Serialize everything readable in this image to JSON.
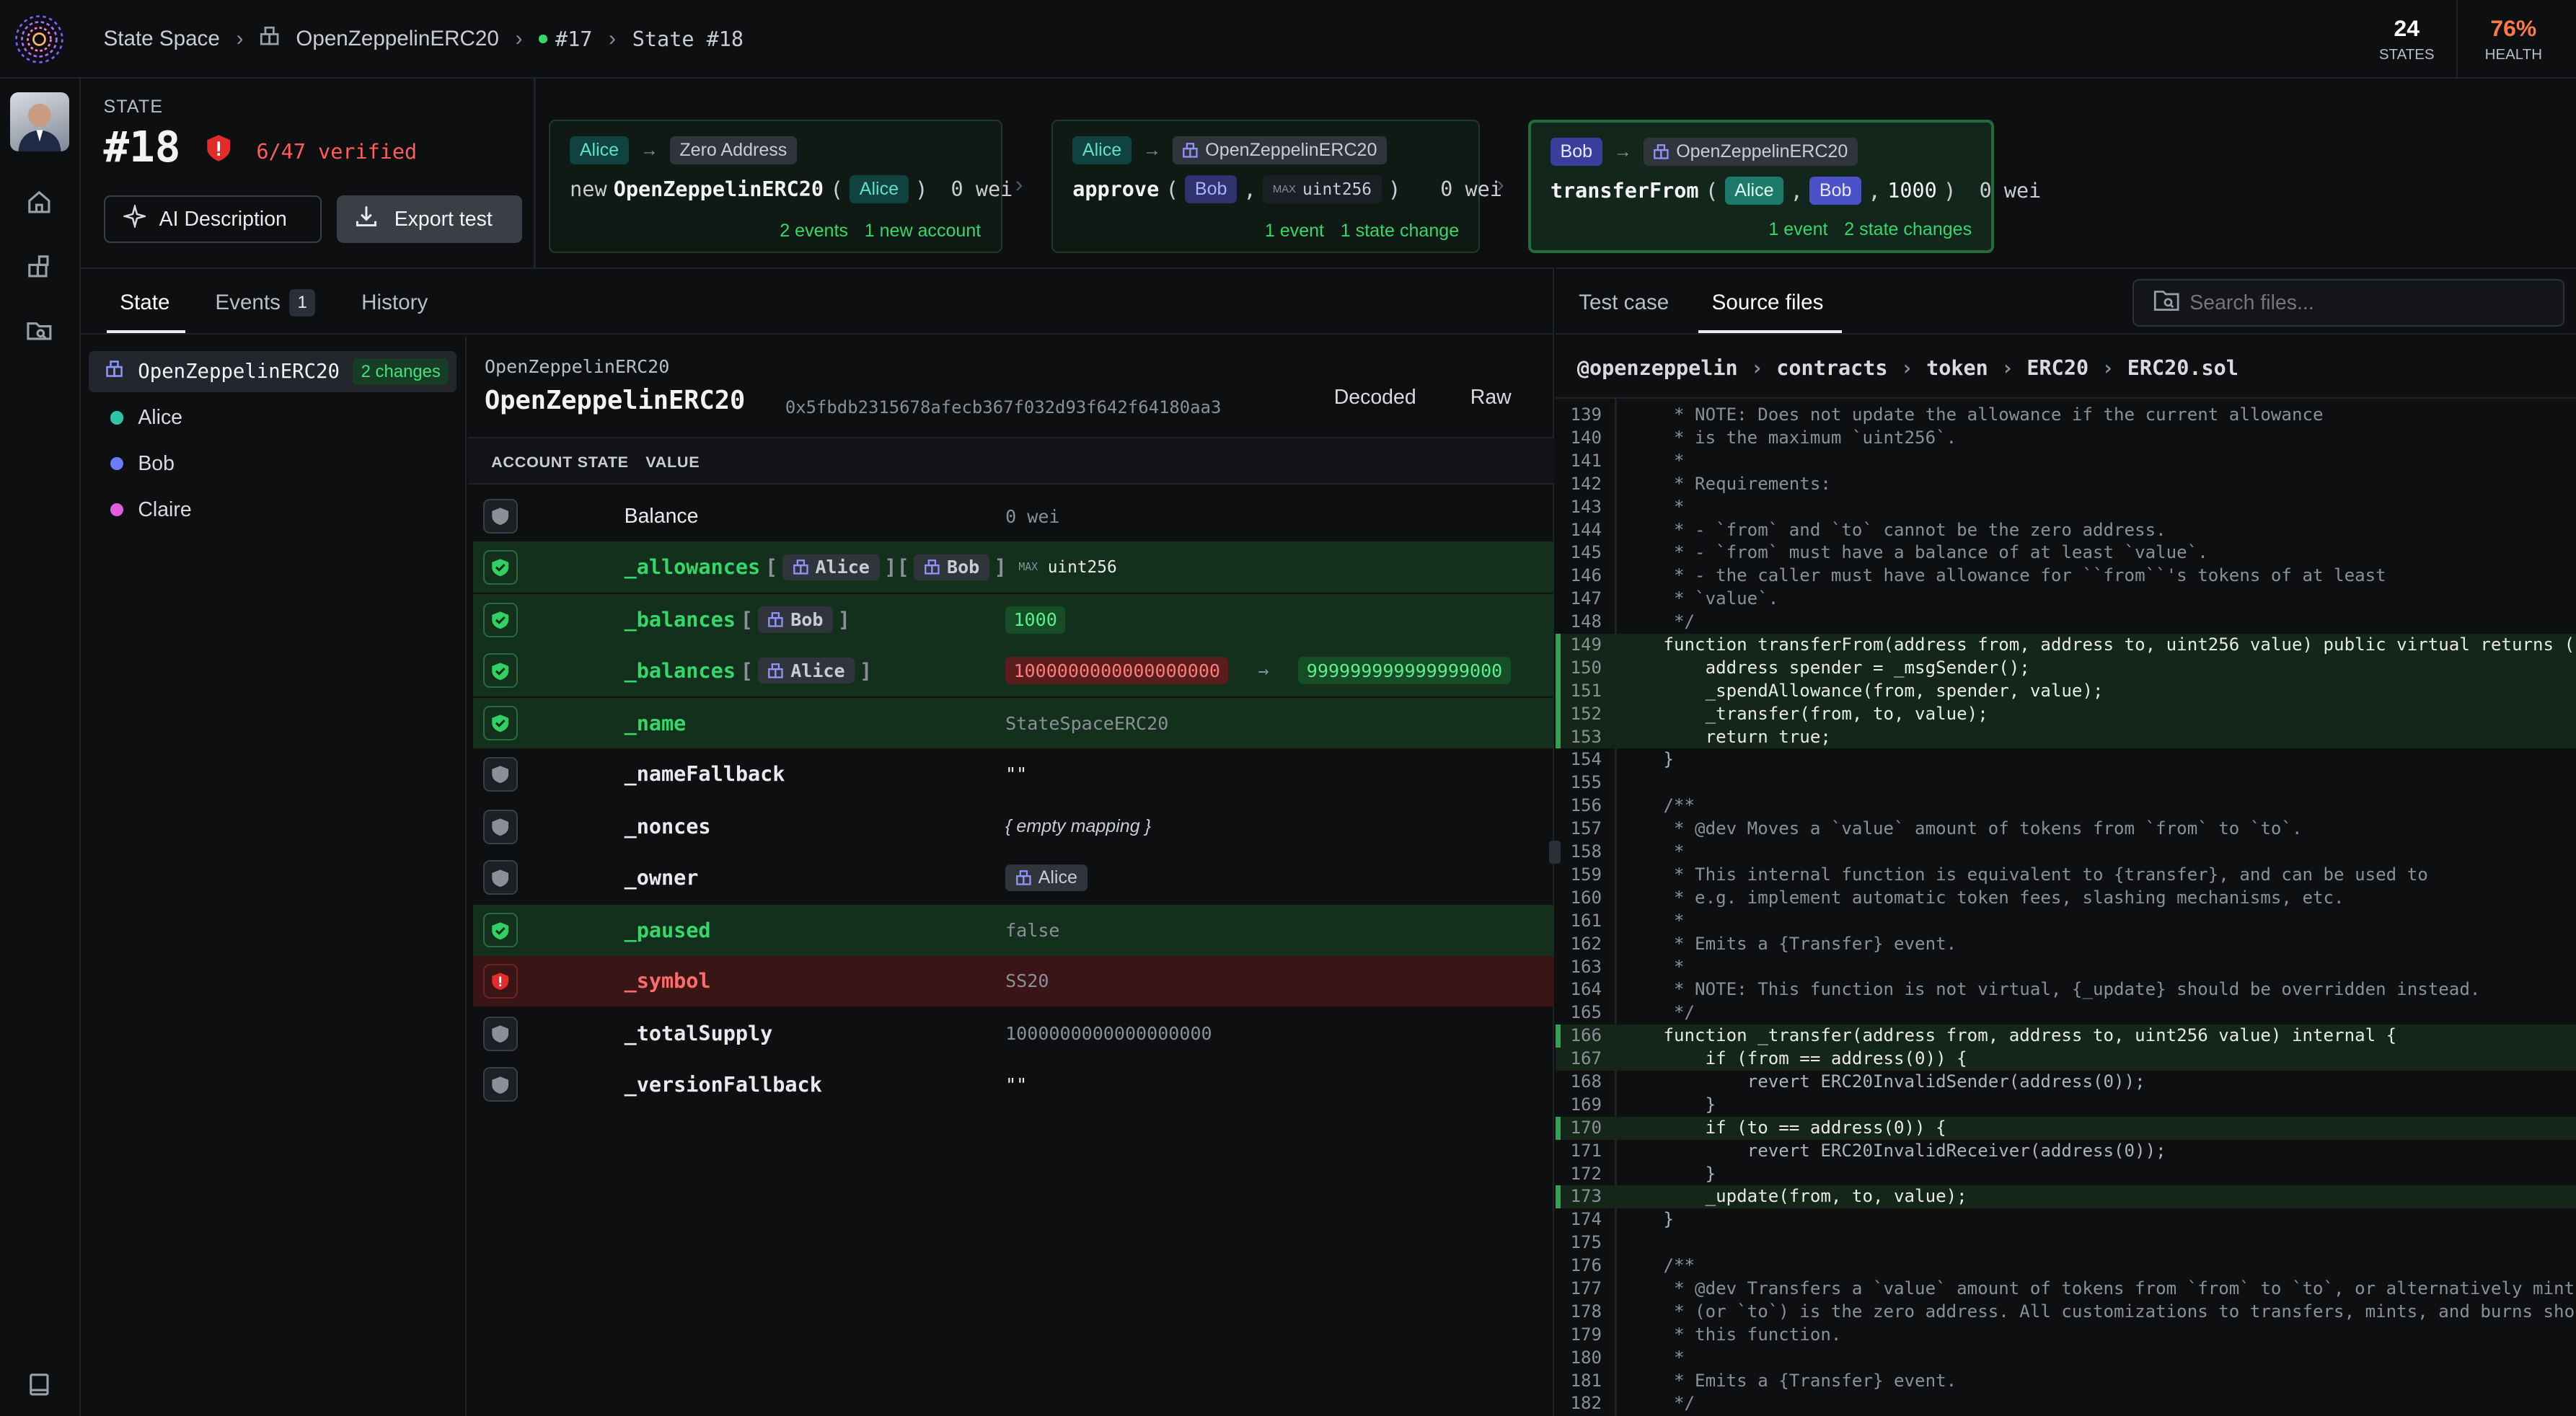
{
  "topbar": {
    "crumb1": "State Space",
    "crumb2": "OpenZeppelinERC20",
    "crumb3": "#17",
    "crumb4": "State #18",
    "states_value": "24",
    "states_label": "STATES",
    "health_value": "76%",
    "health_label": "HEALTH"
  },
  "state": {
    "label": "STATE",
    "number": "#18",
    "verified": "6/47 verified",
    "ai_button": "AI Description",
    "export_button": "Export test"
  },
  "actions": [
    {
      "from": "Alice",
      "to": "Zero Address",
      "prefix": "new",
      "fn": "OpenZeppelinERC20",
      "arg1": "Alice",
      "value": "0 wei",
      "foot1": "2 events",
      "foot2": "1 new account"
    },
    {
      "from": "Alice",
      "to": "OpenZeppelinERC20",
      "fn": "approve",
      "arg1": "Bob",
      "max_label": "MAX",
      "arg2": "uint256",
      "value": "0 wei",
      "foot1": "1 event",
      "foot2": "1 state change"
    },
    {
      "from": "Bob",
      "to": "OpenZeppelinERC20",
      "fn": "transferFrom",
      "arg1": "Alice",
      "arg2": "Bob",
      "arg3": "1000",
      "value": "0 wei",
      "foot1": "1 event",
      "foot2": "2 state changes"
    }
  ],
  "tabs": {
    "state": "State",
    "events": "Events",
    "events_count": "1",
    "history": "History",
    "testcase": "Test case",
    "source": "Source files"
  },
  "search": {
    "placeholder": "Search files..."
  },
  "accounts": [
    {
      "name": "OpenZeppelinERC20",
      "badge": "2 changes"
    },
    {
      "name": "Alice",
      "color": "#2ec4a6"
    },
    {
      "name": "Bob",
      "color": "#6c7bff"
    },
    {
      "name": "Claire",
      "color": "#e05ee0"
    }
  ],
  "detail": {
    "small": "OpenZeppelinERC20",
    "title": "OpenZeppelinERC20",
    "address": "0x5fbdb2315678afecb367f032d93f642f64180aa3",
    "decoded": "Decoded",
    "raw": "Raw",
    "col1": "ACCOUNT STATE",
    "col2": "VALUE"
  },
  "vars": [
    {
      "name": "Balance",
      "value": "0 wei"
    },
    {
      "name": "_allowances",
      "k1": "Alice",
      "k2": "Bob",
      "max": "MAX",
      "value": "uint256"
    },
    {
      "name": "_balances",
      "k1": "Bob",
      "value": "1000"
    },
    {
      "name": "_balances",
      "k1": "Alice",
      "old": "1000000000000000000",
      "new": "999999999999999000"
    },
    {
      "name": "_name",
      "value": "StateSpaceERC20"
    },
    {
      "name": "_nameFallback",
      "value": "\"\""
    },
    {
      "name": "_nonces",
      "value": "{ empty mapping }"
    },
    {
      "name": "_owner",
      "value": "Alice"
    },
    {
      "name": "_paused",
      "value": "false"
    },
    {
      "name": "_symbol",
      "value": "SS20"
    },
    {
      "name": "_totalSupply",
      "value": "1000000000000000000"
    },
    {
      "name": "_versionFallback",
      "value": "\"\""
    }
  ],
  "path": {
    "p1": "@openzeppelin",
    "p2": "contracts",
    "p3": "token",
    "p4": "ERC20",
    "p5": "ERC20.sol"
  },
  "code": [
    {
      "n": "139",
      "t": "     * NOTE: Does not update the allowance if the current allowance"
    },
    {
      "n": "140",
      "t": "     * is the maximum `uint256`."
    },
    {
      "n": "141",
      "t": "     *"
    },
    {
      "n": "142",
      "t": "     * Requirements:"
    },
    {
      "n": "143",
      "t": "     *"
    },
    {
      "n": "144",
      "t": "     * - `from` and `to` cannot be the zero address."
    },
    {
      "n": "145",
      "t": "     * - `from` must have a balance of at least `value`."
    },
    {
      "n": "146",
      "t": "     * - the caller must have allowance for ``from``'s tokens of at least"
    },
    {
      "n": "147",
      "t": "     * `value`."
    },
    {
      "n": "148",
      "t": "     */"
    },
    {
      "n": "149",
      "t": "    function transferFrom(address from, address to, uint256 value) public virtual returns (bool) {"
    },
    {
      "n": "150",
      "t": "        address spender = _msgSender();"
    },
    {
      "n": "151",
      "t": "        _spendAllowance(from, spender, value);"
    },
    {
      "n": "152",
      "t": "        _transfer(from, to, value);"
    },
    {
      "n": "153",
      "t": "        return true;"
    },
    {
      "n": "154",
      "t": "    }"
    },
    {
      "n": "155",
      "t": ""
    },
    {
      "n": "156",
      "t": "    /**"
    },
    {
      "n": "157",
      "t": "     * @dev Moves a `value` amount of tokens from `from` to `to`."
    },
    {
      "n": "158",
      "t": "     *"
    },
    {
      "n": "159",
      "t": "     * This internal function is equivalent to {transfer}, and can be used to"
    },
    {
      "n": "160",
      "t": "     * e.g. implement automatic token fees, slashing mechanisms, etc."
    },
    {
      "n": "161",
      "t": "     *"
    },
    {
      "n": "162",
      "t": "     * Emits a {Transfer} event."
    },
    {
      "n": "163",
      "t": "     *"
    },
    {
      "n": "164",
      "t": "     * NOTE: This function is not virtual, {_update} should be overridden instead."
    },
    {
      "n": "165",
      "t": "     */"
    },
    {
      "n": "166",
      "t": "    function _transfer(address from, address to, uint256 value) internal {"
    },
    {
      "n": "167",
      "t": "        if (from == address(0)) {"
    },
    {
      "n": "168",
      "t": "            revert ERC20InvalidSender(address(0));"
    },
    {
      "n": "169",
      "t": "        }"
    },
    {
      "n": "170",
      "t": "        if (to == address(0)) {"
    },
    {
      "n": "171",
      "t": "            revert ERC20InvalidReceiver(address(0));"
    },
    {
      "n": "172",
      "t": "        }"
    },
    {
      "n": "173",
      "t": "        _update(from, to, value);"
    },
    {
      "n": "174",
      "t": "    }"
    },
    {
      "n": "175",
      "t": ""
    },
    {
      "n": "176",
      "t": "    /**"
    },
    {
      "n": "177",
      "t": "     * @dev Transfers a `value` amount of tokens from `from` to `to`, or alternatively mints (or burns) if `from`"
    },
    {
      "n": "178",
      "t": "     * (or `to`) is the zero address. All customizations to transfers, mints, and burns should be done by overriding"
    },
    {
      "n": "179",
      "t": "     * this function."
    },
    {
      "n": "180",
      "t": "     *"
    },
    {
      "n": "181",
      "t": "     * Emits a {Transfer} event."
    },
    {
      "n": "182",
      "t": "     */"
    }
  ]
}
